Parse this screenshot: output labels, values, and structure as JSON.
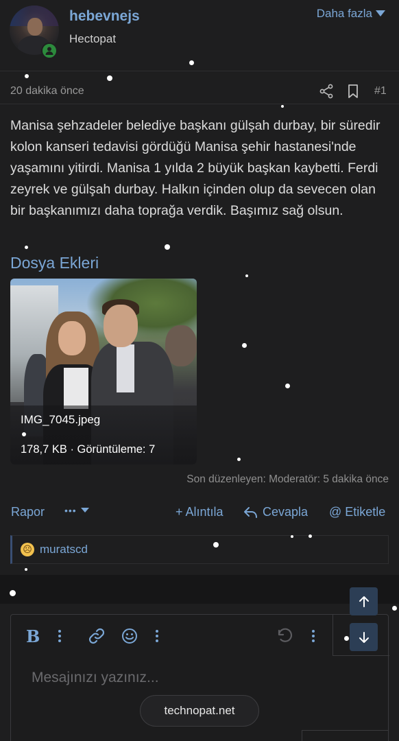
{
  "user": {
    "username": "hebevnejs",
    "title": "Hectopat",
    "more_label": "Daha fazla"
  },
  "post": {
    "timestamp": "20 dakika önce",
    "number": "#1",
    "body": "Manisa şehzadeler belediye başkanı gülşah durbay, bir süredir kolon kanseri tedavisi gördüğü Manisa şehir hastanesi'nde yaşamını yitirdi. Manisa 1 yılda 2 büyük başkan kaybetti. Ferdi zeyrek ve gülşah durbay. Halkın içinden olup da sevecen olan bir başkanımızı daha toprağa verdik. Başımız sağ olsun.",
    "attachments_title": "Dosya Ekleri",
    "attachment": {
      "filename": "IMG_7045.jpeg",
      "info": "178,7 KB · Görüntüleme: 7"
    },
    "edited_note": "Son düzenleyen: Moderatör: 5 dakika önce"
  },
  "actions": {
    "report": "Rapor",
    "more": "•••",
    "quote": "+ Alıntıla",
    "reply": "Cevapla",
    "tag": "@ Etiketle"
  },
  "reactions": {
    "emoji": "sad-face",
    "user": "muratscd"
  },
  "editor": {
    "placeholder": "Mesajınızı yazınız...",
    "bold_label": "B"
  },
  "site_pill": "technopat.net",
  "colors": {
    "accent": "#7ba7d6",
    "background": "#1e1e1f",
    "online": "#2c8a3c",
    "scroll_button": "#2c3e55"
  }
}
